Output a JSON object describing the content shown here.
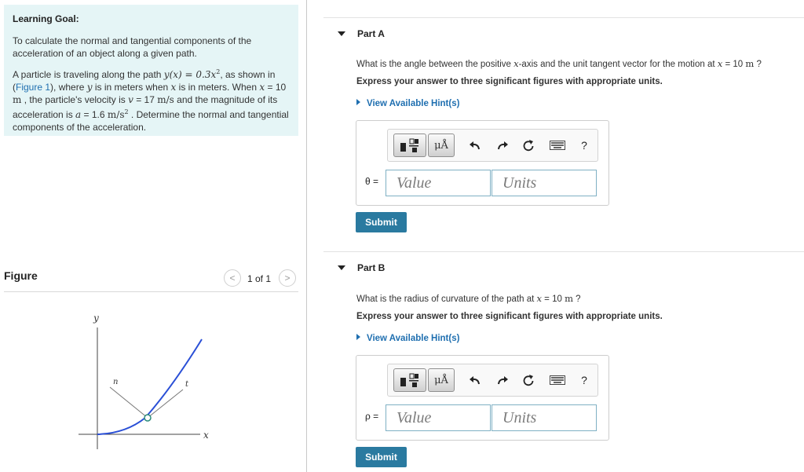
{
  "learning_goal": {
    "title": "Learning Goal:",
    "intro": "To calculate the normal and tangential components of the acceleration of an object along a given path.",
    "p2_a": "A particle is traveling along the path ",
    "p2_eq_lhs": "y(x) = 0.3x",
    "p2_eq_exp": "2",
    "p2_b": ", as shown in (",
    "figure_link": "Figure 1",
    "p2_c": "), where ",
    "p2_y": "y",
    "p2_d": " is in meters when ",
    "p2_x": "x",
    "p2_e": " is in meters. When ",
    "p2_x2": "x",
    "p2_f": " = 10 ",
    "p2_m1": "m",
    "p2_g": " , the particle's velocity is ",
    "p2_v": "v",
    "p2_h": " = 17 ",
    "p2_unit_v": "m/s",
    "p2_i": " and the magnitude of its acceleration is ",
    "p2_a_sym": "a",
    "p2_j": " = 1.6 ",
    "p2_unit_a": "m/s",
    "p2_unit_a_exp": "2",
    "p2_k": " . Determine the normal and tangential components of the acceleration."
  },
  "figure": {
    "title": "Figure",
    "pager": "1 of 1",
    "prev_icon": "<",
    "next_icon": ">",
    "labels": {
      "y": "y",
      "x": "x",
      "n": "n",
      "t": "t"
    }
  },
  "parts": [
    {
      "label": "Part A",
      "question_a": "What is the angle between the positive ",
      "question_x": "x",
      "question_b": "-axis and the unit tangent vector for the motion at ",
      "question_x2": "x",
      "question_c": " = 10 ",
      "question_m": "m",
      "question_d": " ?",
      "instruction": "Express your answer to three significant figures with appropriate units.",
      "hint": "View Available Hint(s)",
      "variable": "θ =",
      "value_placeholder": "Value",
      "units_placeholder": "Units",
      "submit": "Submit"
    },
    {
      "label": "Part B",
      "question_a": "What is the radius of curvature of the path at ",
      "question_x": "x",
      "question_c": " = 10 ",
      "question_m": "m",
      "question_d": " ?",
      "instruction": "Express your answer to three significant figures with appropriate units.",
      "hint": "View Available Hint(s)",
      "variable": "ρ =",
      "value_placeholder": "Value",
      "units_placeholder": "Units",
      "submit": "Submit"
    }
  ],
  "toolbar": {
    "mu_label": "μÅ",
    "help_label": "?",
    "icons": [
      "templates-icon",
      "units-icon",
      "undo-icon",
      "redo-icon",
      "reset-icon",
      "keyboard-icon",
      "help-icon"
    ]
  },
  "colors": {
    "link": "#1f6fb0",
    "goal_bg": "#e5f5f6",
    "submit_bg": "#2a7aa0",
    "curve": "#2a4fd6"
  }
}
